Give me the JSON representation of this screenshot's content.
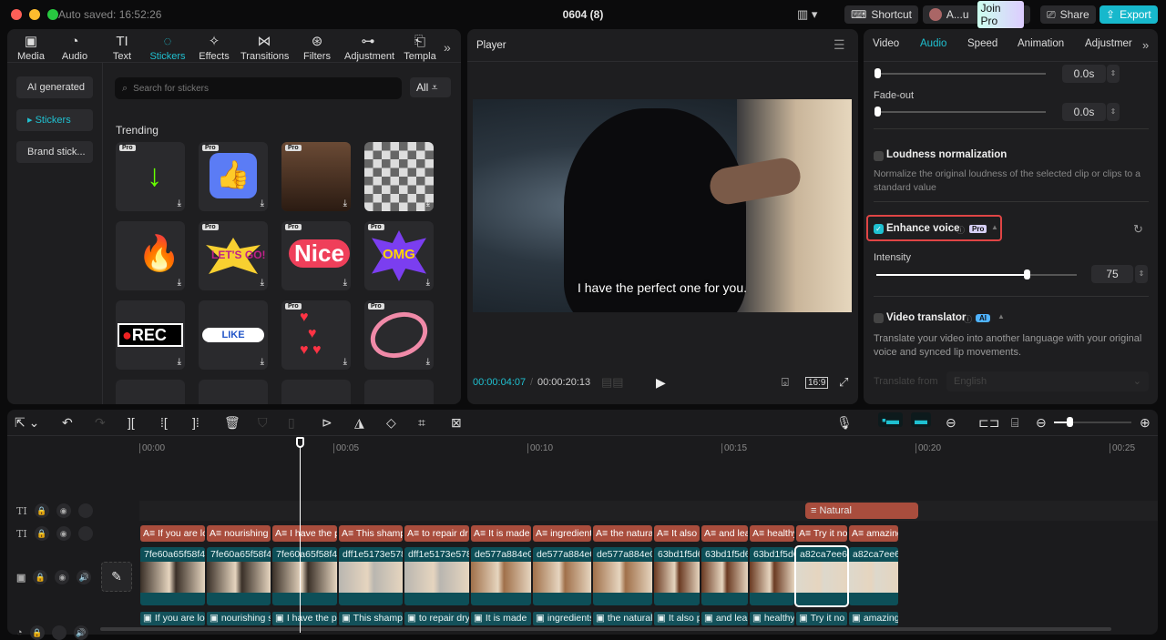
{
  "titlebar": {
    "autosave": "Auto saved: 16:52:26",
    "project_title": "0604 (8)",
    "shortcut": "Shortcut",
    "user": "A...u",
    "join_pro": "Join Pro",
    "share": "Share",
    "export": "Export"
  },
  "media_tabs": [
    {
      "label": "Media",
      "icon": "▣"
    },
    {
      "label": "Audio",
      "icon": "◔"
    },
    {
      "label": "Text",
      "icon": "TI"
    },
    {
      "label": "Stickers",
      "icon": "◌"
    },
    {
      "label": "Effects",
      "icon": "✧"
    },
    {
      "label": "Transitions",
      "icon": "⋈"
    },
    {
      "label": "Filters",
      "icon": "⊛"
    },
    {
      "label": "Adjustment",
      "icon": "⊶"
    },
    {
      "label": "Templa",
      "icon": "⎗"
    }
  ],
  "sticker_sidebar": [
    "AI generated",
    "Stickers",
    "Brand stick..."
  ],
  "search": {
    "placeholder": "Search for stickers",
    "filter": "All"
  },
  "section_title": "Trending",
  "stickers": [
    {
      "kind": "arrow",
      "pro": "Pro"
    },
    {
      "kind": "thumbs-up",
      "pro": "Pro"
    },
    {
      "kind": "meme-face",
      "pro": "Pro"
    },
    {
      "kind": "pixel-mosaic",
      "pro": ""
    },
    {
      "kind": "fire",
      "pro": ""
    },
    {
      "kind": "lets-go",
      "pro": "Pro",
      "text": "LET'S GO!"
    },
    {
      "kind": "nice",
      "pro": "Pro",
      "text": "Nice"
    },
    {
      "kind": "omg",
      "pro": "Pro",
      "text": "OMG"
    },
    {
      "kind": "rec",
      "pro": "",
      "text": "REC"
    },
    {
      "kind": "like",
      "pro": "",
      "text": "LIKE"
    },
    {
      "kind": "hearts",
      "pro": "Pro"
    },
    {
      "kind": "circle",
      "pro": "Pro"
    }
  ],
  "player": {
    "title": "Player",
    "subtitle": "I have the perfect one for you.",
    "current_time": "00:00:04:07",
    "total_time": "00:00:20:13",
    "ratio": "16:9"
  },
  "inspector": {
    "tabs": [
      "Video",
      "Audio",
      "Speed",
      "Animation",
      "Adjustmer"
    ],
    "active_tab": "Audio",
    "fade_in_value": "0.0s",
    "fade_out_label": "Fade-out",
    "fade_out_value": "0.0s",
    "loudness_label": "Loudness normalization",
    "loudness_desc": "Normalize the original loudness of the selected clip or clips to a standard value",
    "enhance_label": "Enhance voice",
    "enhance_badge": "Pro",
    "enhance_checked": true,
    "intensity_label": "Intensity",
    "intensity_value": "75",
    "intensity_fraction": 0.75,
    "translator_label": "Video translator",
    "translator_badge": "AI",
    "translator_desc": "Translate your video into another language with your original voice and synced lip movements.",
    "translate_from_label": "Translate from",
    "translate_from_value": "English"
  },
  "timeline": {
    "ruler": [
      "00:00",
      "00:05",
      "00:10",
      "00:15",
      "00:20",
      "00:25"
    ],
    "playhead_seconds": 4.13,
    "title_clip": "Natural",
    "text_clips": [
      "If you are lo",
      "nourishing s",
      "I have the p",
      "This shamp",
      "to repair dr",
      "It is made",
      "ingredients",
      "the natura",
      "It also p",
      "and lea",
      "healthy",
      "Try it no",
      "amazing"
    ],
    "video_clips": [
      "7fe60a65f58f4",
      "7fe60a65f58f4",
      "7fe60a65f58f4",
      "dff1e5173e578",
      "dff1e5173e578",
      "de577a884e0",
      "de577a884e0",
      "de577a884e0",
      "63bd1f5d6",
      "63bd1f5d6",
      "63bd1f5d6",
      "a82ca7ee6",
      "a82ca7ee6"
    ],
    "caption_clips": [
      "If you are lo",
      "nourishing s",
      "I have the p",
      "This shamp",
      "to repair dry",
      "It is made",
      "ingredients",
      "the natural",
      "It also p",
      "and lea",
      "healthy",
      "Try it no",
      "amazing"
    ]
  },
  "colors": {
    "accent": "#1fc0d0",
    "text_clip": "#a94d3d",
    "video_clip": "#0d4f58",
    "highlight": "#e04545"
  }
}
